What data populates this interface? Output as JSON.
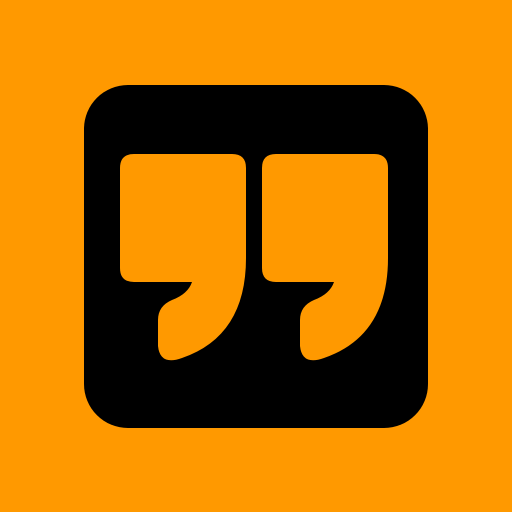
{
  "app_icon": {
    "name": "quote-icon",
    "colors": {
      "background": "#FF9900",
      "tile": "#000000",
      "glyph": "#FF9900"
    }
  }
}
